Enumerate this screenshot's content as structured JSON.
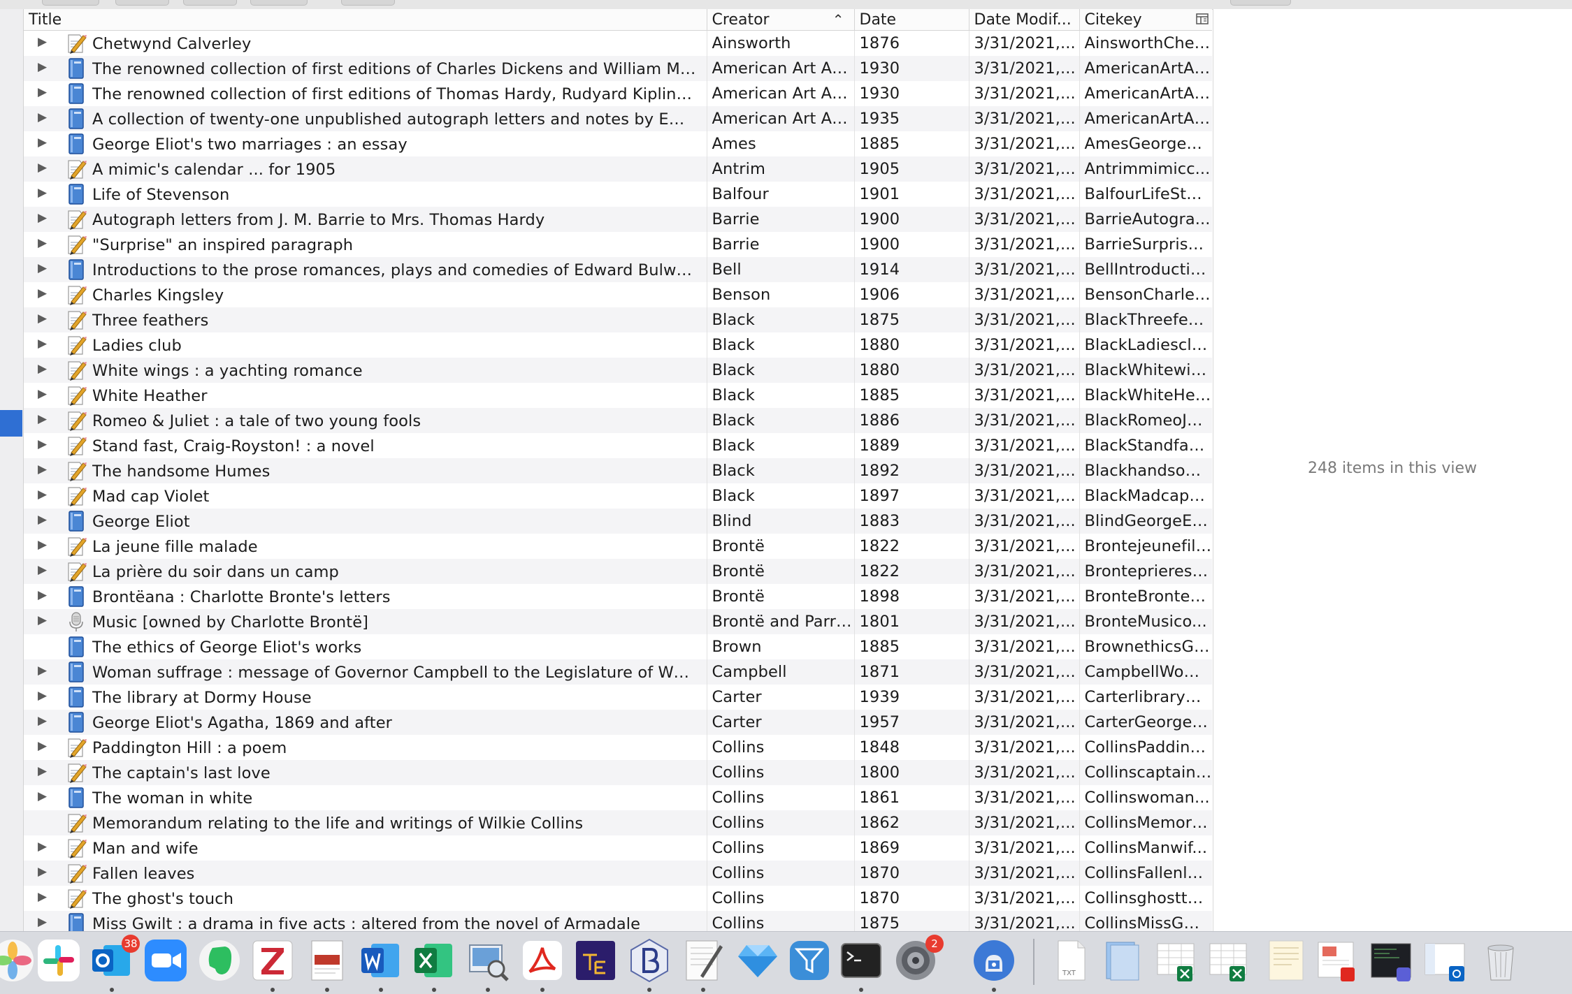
{
  "table": {
    "columns": {
      "title": "Title",
      "creator": "Creator",
      "date": "Date",
      "date_modified": "Date Modif...",
      "citekey": "Citekey"
    },
    "sort_column": "Creator",
    "sort_direction": "ascending",
    "rows": [
      {
        "title": "Chetwynd Calverley",
        "creator": "Ainsworth",
        "date": "1876",
        "modified": "3/31/2021,...",
        "citekey": "AinsworthChet...",
        "icon": "manuscript-icon",
        "expander": true
      },
      {
        "title": "The renowned collection of first editions of Charles Dickens and William Makep...",
        "creator": "American Art As...",
        "date": "1930",
        "modified": "3/31/2021,...",
        "citekey": "AmericanArtAs...",
        "icon": "book-icon",
        "expander": true
      },
      {
        "title": "The renowned collection of first editions of Thomas Hardy, Rudyard Kipling, Ro...",
        "creator": "American Art As...",
        "date": "1930",
        "modified": "3/31/2021,...",
        "citekey": "AmericanArtAs...",
        "icon": "book-icon",
        "expander": true
      },
      {
        "title": "A collection of twenty-one unpublished autograph letters and notes by Emily D...",
        "creator": "American Art As...",
        "date": "1935",
        "modified": "3/31/2021,...",
        "citekey": "AmericanArtAs...",
        "icon": "book-icon",
        "expander": true
      },
      {
        "title": "George Eliot's two marriages : an essay",
        "creator": "Ames",
        "date": "1885",
        "modified": "3/31/2021,...",
        "citekey": "AmesGeorgeEl...",
        "icon": "book-icon",
        "expander": true
      },
      {
        "title": "A mimic's calendar ... for 1905",
        "creator": "Antrim",
        "date": "1905",
        "modified": "3/31/2021,...",
        "citekey": "Antrimmimicc...",
        "icon": "manuscript-icon",
        "expander": true
      },
      {
        "title": "Life of Stevenson",
        "creator": "Balfour",
        "date": "1901",
        "modified": "3/31/2021,...",
        "citekey": "BalfourLifeStev...",
        "icon": "book-icon",
        "expander": true
      },
      {
        "title": "Autograph letters from J. M. Barrie to Mrs. Thomas Hardy",
        "creator": "Barrie",
        "date": "1900",
        "modified": "3/31/2021,...",
        "citekey": "BarrieAutogra...",
        "icon": "manuscript-icon",
        "expander": true
      },
      {
        "title": "\"Surprise\" an inspired paragraph",
        "creator": "Barrie",
        "date": "1900",
        "modified": "3/31/2021,...",
        "citekey": "BarrieSurprisei...",
        "icon": "manuscript-icon",
        "expander": true
      },
      {
        "title": "Introductions to the prose romances, plays and comedies of Edward Bulwer lor...",
        "creator": "Bell",
        "date": "1914",
        "modified": "3/31/2021,...",
        "citekey": "BellIntroductio...",
        "icon": "book-icon",
        "expander": true
      },
      {
        "title": "Charles Kingsley",
        "creator": "Benson",
        "date": "1906",
        "modified": "3/31/2021,...",
        "citekey": "BensonCharles...",
        "icon": "manuscript-icon",
        "expander": true
      },
      {
        "title": "Three feathers",
        "creator": "Black",
        "date": "1875",
        "modified": "3/31/2021,...",
        "citekey": "BlackThreefeat...",
        "icon": "manuscript-icon",
        "expander": true
      },
      {
        "title": "Ladies club",
        "creator": "Black",
        "date": "1880",
        "modified": "3/31/2021,...",
        "citekey": "BlackLadiesclu...",
        "icon": "manuscript-icon",
        "expander": true
      },
      {
        "title": "White wings : a yachting romance",
        "creator": "Black",
        "date": "1880",
        "modified": "3/31/2021,...",
        "citekey": "BlackWhitewin...",
        "icon": "manuscript-icon",
        "expander": true
      },
      {
        "title": "White Heather",
        "creator": "Black",
        "date": "1885",
        "modified": "3/31/2021,...",
        "citekey": "BlackWhiteHea...",
        "icon": "manuscript-icon",
        "expander": true
      },
      {
        "title": "Romeo & Juliet : a tale of two young fools",
        "creator": "Black",
        "date": "1886",
        "modified": "3/31/2021,...",
        "citekey": "BlackRomeoJul...",
        "icon": "manuscript-icon",
        "expander": true
      },
      {
        "title": "Stand fast, Craig-Royston! : a novel",
        "creator": "Black",
        "date": "1889",
        "modified": "3/31/2021,...",
        "citekey": "BlackStandfast...",
        "icon": "manuscript-icon",
        "expander": true
      },
      {
        "title": "The handsome Humes",
        "creator": "Black",
        "date": "1892",
        "modified": "3/31/2021,...",
        "citekey": "Blackhandsom...",
        "icon": "manuscript-icon",
        "expander": true
      },
      {
        "title": "Mad cap Violet",
        "creator": "Black",
        "date": "1897",
        "modified": "3/31/2021,...",
        "citekey": "BlackMadcapVi...",
        "icon": "manuscript-icon",
        "expander": true
      },
      {
        "title": "George Eliot",
        "creator": "Blind",
        "date": "1883",
        "modified": "3/31/2021,...",
        "citekey": "BlindGeorgeEli...",
        "icon": "book-icon",
        "expander": true
      },
      {
        "title": "La jeune fille malade",
        "creator": "Brontë",
        "date": "1822",
        "modified": "3/31/2021,...",
        "citekey": "Brontejeunefill...",
        "icon": "manuscript-icon",
        "expander": true
      },
      {
        "title": "La prière du soir dans un camp",
        "creator": "Brontë",
        "date": "1822",
        "modified": "3/31/2021,...",
        "citekey": "Bronteprieresо...",
        "icon": "manuscript-icon",
        "expander": true
      },
      {
        "title": "Brontëana : Charlotte Bronte's letters",
        "creator": "Brontë",
        "date": "1898",
        "modified": "3/31/2021,...",
        "citekey": "BronteBrontea...",
        "icon": "book-icon",
        "expander": true
      },
      {
        "title": "Music [owned by Charlotte Brontë]",
        "creator": "Brontë and Parrish",
        "date": "1801",
        "modified": "3/31/2021,...",
        "citekey": "BronteMusico...",
        "icon": "audio-icon",
        "expander": true
      },
      {
        "title": "The ethics of George Eliot's works",
        "creator": "Brown",
        "date": "1885",
        "modified": "3/31/2021,...",
        "citekey": "BrownethicsGe...",
        "icon": "book-icon",
        "expander": false
      },
      {
        "title": "Woman suffrage : message of Governor Campbell to the Legislature of Wyomin...",
        "creator": "Campbell",
        "date": "1871",
        "modified": "3/31/2021,...",
        "citekey": "CampbellWom...",
        "icon": "book-icon",
        "expander": true
      },
      {
        "title": "The library at Dormy House",
        "creator": "Carter",
        "date": "1939",
        "modified": "3/31/2021,...",
        "citekey": "CarterlibraryD...",
        "icon": "book-icon",
        "expander": true
      },
      {
        "title": "George Eliot's Agatha, 1869 and after",
        "creator": "Carter",
        "date": "1957",
        "modified": "3/31/2021,...",
        "citekey": "CarterGeorgeE...",
        "icon": "book-icon",
        "expander": true
      },
      {
        "title": "Paddington Hill : a poem",
        "creator": "Collins",
        "date": "1848",
        "modified": "3/31/2021,...",
        "citekey": "CollinsPadding...",
        "icon": "manuscript-icon",
        "expander": true
      },
      {
        "title": "The captain's last love",
        "creator": "Collins",
        "date": "1800",
        "modified": "3/31/2021,...",
        "citekey": "Collinscaptainl...",
        "icon": "manuscript-icon",
        "expander": true
      },
      {
        "title": "The woman in white",
        "creator": "Collins",
        "date": "1861",
        "modified": "3/31/2021,...",
        "citekey": "Collinswoman...",
        "icon": "book-icon",
        "expander": true
      },
      {
        "title": "Memorandum relating to the life and writings of Wilkie Collins",
        "creator": "Collins",
        "date": "1862",
        "modified": "3/31/2021,...",
        "citekey": "CollinsMemora...",
        "icon": "manuscript-icon",
        "expander": false
      },
      {
        "title": "Man and wife",
        "creator": "Collins",
        "date": "1869",
        "modified": "3/31/2021,...",
        "citekey": "CollinsManwif...",
        "icon": "manuscript-icon",
        "expander": true
      },
      {
        "title": "Fallen leaves",
        "creator": "Collins",
        "date": "1870",
        "modified": "3/31/2021,...",
        "citekey": "CollinsFallenle...",
        "icon": "manuscript-icon",
        "expander": true
      },
      {
        "title": "The ghost's touch",
        "creator": "Collins",
        "date": "1870",
        "modified": "3/31/2021,...",
        "citekey": "Collinsghostto...",
        "icon": "manuscript-icon",
        "expander": true
      },
      {
        "title": "Miss Gwilt : a drama in five acts : altered from the novel of Armadale",
        "creator": "Collins",
        "date": "1875",
        "modified": "3/31/2021,...",
        "citekey": "CollinsMissGwi...",
        "icon": "book-icon",
        "expander": true
      }
    ]
  },
  "side_panel": {
    "item_count": "248 items in this view"
  },
  "dock": {
    "apps": [
      {
        "name": "Photos",
        "icon": "photos-icon",
        "running": false,
        "badge": ""
      },
      {
        "name": "Slack",
        "icon": "slack-icon",
        "running": false,
        "badge": ""
      },
      {
        "name": "Outlook",
        "icon": "outlook-icon",
        "running": true,
        "badge": "38"
      },
      {
        "name": "Zoom",
        "icon": "zoom-icon",
        "running": false,
        "badge": ""
      },
      {
        "name": "Evernote",
        "icon": "evernote-icon",
        "running": false,
        "badge": ""
      },
      {
        "name": "Zotero",
        "icon": "zotero-icon",
        "running": true,
        "badge": ""
      },
      {
        "name": "Mail Merge",
        "icon": "mailmerge-icon",
        "running": true,
        "badge": ""
      },
      {
        "name": "Word",
        "icon": "word-icon",
        "running": true,
        "badge": ""
      },
      {
        "name": "Excel",
        "icon": "excel-icon",
        "running": true,
        "badge": ""
      },
      {
        "name": "Preview",
        "icon": "preview-icon",
        "running": true,
        "badge": ""
      },
      {
        "name": "Acrobat",
        "icon": "acrobat-icon",
        "running": true,
        "badge": ""
      },
      {
        "name": "TeXShop",
        "icon": "tex-icon",
        "running": false,
        "badge": ""
      },
      {
        "name": "BBEdit",
        "icon": "bbedit-icon",
        "running": true,
        "badge": ""
      },
      {
        "name": "TextEdit",
        "icon": "textedit-icon",
        "running": true,
        "badge": ""
      },
      {
        "name": "Sketch",
        "icon": "sketch-icon",
        "running": false,
        "badge": ""
      },
      {
        "name": "Filter",
        "icon": "filter-icon",
        "running": false,
        "badge": ""
      },
      {
        "name": "Terminal",
        "icon": "terminal-icon",
        "running": true,
        "badge": ""
      },
      {
        "name": "System Preferences",
        "icon": "system-preferences-icon",
        "running": false,
        "badge": "2"
      },
      {
        "name": "Security",
        "icon": "security-icon",
        "running": true,
        "badge": ""
      }
    ],
    "documents": [
      {
        "icon": "txt-document-icon",
        "label": "TXT"
      },
      {
        "icon": "folder-stack-icon",
        "label": ""
      },
      {
        "icon": "excel-document-icon",
        "label": ""
      },
      {
        "icon": "excel-document-icon",
        "label": ""
      },
      {
        "icon": "document-thumbnail-icon",
        "label": ""
      },
      {
        "icon": "pdf-document-icon",
        "label": ""
      },
      {
        "icon": "terminal-window-icon",
        "label": ""
      },
      {
        "icon": "outlook-window-icon",
        "label": ""
      },
      {
        "icon": "trash-icon",
        "label": ""
      }
    ]
  },
  "colors": {
    "row_alt": "#f4f4f6",
    "selection": "#2f6fd3",
    "book_icon": "#4a86d4",
    "badge": "#e83b2f"
  }
}
